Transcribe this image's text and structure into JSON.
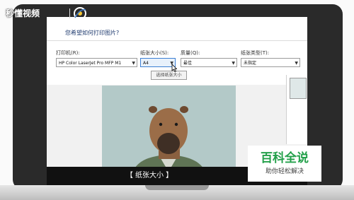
{
  "watermark": {
    "brand": "秒懂视频"
  },
  "dialog": {
    "title": "您希望如何打印图片?",
    "printer_label": "打印机(R):",
    "printer_value": "HP Color LaserJet Pro MFP M1",
    "paper_size_label": "纸张大小(S):",
    "paper_size_value": "A4",
    "quality_label": "质量(Q):",
    "quality_value": "最佳",
    "paper_type_label": "纸张类型(T):",
    "paper_type_value": "未指定",
    "tooltip": "选择纸张大小"
  },
  "caption": "【 纸张大小 】",
  "badge": {
    "title": "百科全说",
    "subtitle": "助你轻松解决"
  },
  "colors": {
    "accent_green": "#23a04a",
    "select_active": "#3c7fd3",
    "preview_bg": "#b3c9c8"
  }
}
